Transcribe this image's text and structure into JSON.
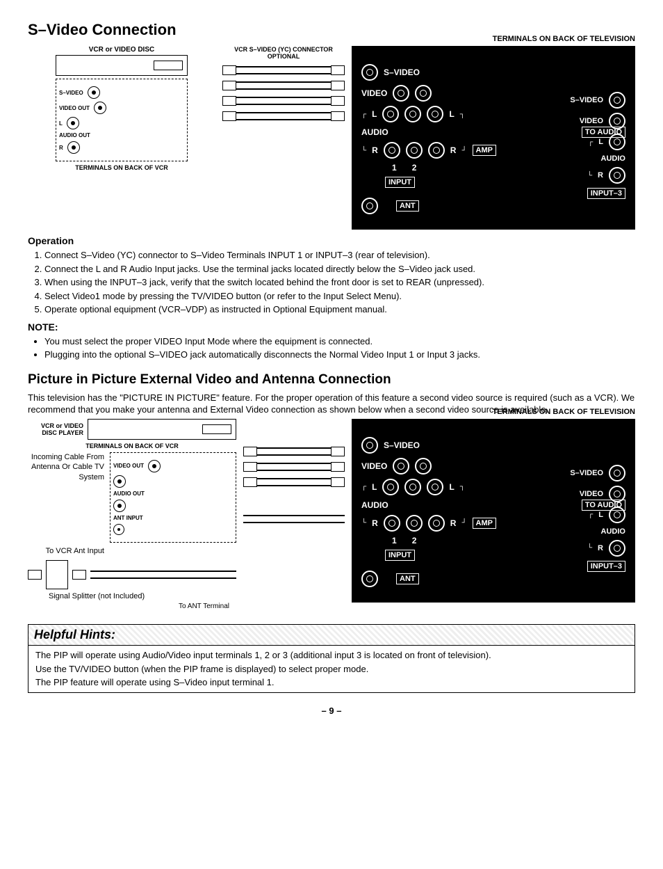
{
  "section1": {
    "title": "S–Video Connection",
    "vcr_label": "VCR or VIDEO DISC",
    "connector_optional": "VCR S–VIDEO (YC) CONNECTOR OPTIONAL",
    "vcr_back_jacks": {
      "svideo": "S–VIDEO",
      "video_out": "VIDEO OUT",
      "audio_out_l": "L",
      "audio_out": "AUDIO OUT",
      "audio_out_r": "R"
    },
    "terminals_vcr": "TERMINALS ON BACK OF VCR",
    "tv_panel_title": "TERMINALS ON BACK OF TELEVISION",
    "tv_labels": {
      "svideo": "S–VIDEO",
      "video": "VIDEO",
      "audio_l": "L",
      "audio": "AUDIO",
      "audio_r": "R",
      "col1": "1",
      "col2": "2",
      "input": "INPUT",
      "to_audio_amp_1": "TO AUDIO",
      "to_audio_amp_2": "AMP",
      "ant": "ANT",
      "input3": "INPUT–3",
      "right_svideo": "S–VIDEO",
      "right_video": "VIDEO",
      "right_audio_l": "L",
      "right_audio": "AUDIO",
      "right_audio_r": "R"
    },
    "operation_heading": "Operation",
    "operation_steps": [
      "Connect S–Video (YC) connector to S–Video Terminals INPUT 1 or INPUT–3 (rear of television).",
      "Connect the L and R Audio Input jacks. Use the terminal jacks located directly below the S–Video jack used.",
      "When using the INPUT–3 jack, verify that the switch located behind the front door is set to REAR (unpressed).",
      "Select Video1 mode by pressing the TV/VIDEO button (or refer to the Input Select Menu).",
      "Operate optional equipment (VCR–VDP) as instructed in Optional Equipment manual."
    ],
    "note_heading": "NOTE:",
    "notes": [
      "You must select the proper VIDEO Input Mode where the equipment is connected.",
      "Plugging into the optional S–VIDEO jack automatically disconnects the Normal Video Input 1 or Input 3 jacks."
    ]
  },
  "section2": {
    "title": "Picture in Picture External Video and Antenna Connection",
    "intro": "This television has the \"PICTURE IN PICTURE\" feature. For the proper operation of this feature a second video source is required (such as a VCR). We recommend that you make your antenna and External Video connection as shown below when a second video source is available.",
    "vcr_player": "VCR or VIDEO DISC PLAYER",
    "terminals_vcr": "TERMINALS ON BACK OF VCR",
    "vcr_back": {
      "video_out": "VIDEO OUT",
      "audio_out": "AUDIO OUT",
      "ant_input": "ANT INPUT"
    },
    "incoming": "Incoming Cable From Antenna Or Cable TV System",
    "to_vcr": "To VCR Ant Input",
    "splitter": "Signal Splitter (not Included)",
    "to_ant": "To ANT Terminal",
    "tv_panel_title": "TERMINALS ON BACK OF TELEVISION"
  },
  "hints": {
    "title": "Helpful Hints:",
    "lines": [
      "The PIP will operate using Audio/Video input terminals 1, 2 or 3 (additional input 3 is located on front of television).",
      "Use the TV/VIDEO button (when the PIP frame is displayed) to select proper mode.",
      "The PIP feature will operate using S–Video input terminal 1."
    ]
  },
  "page_number": "– 9 –"
}
